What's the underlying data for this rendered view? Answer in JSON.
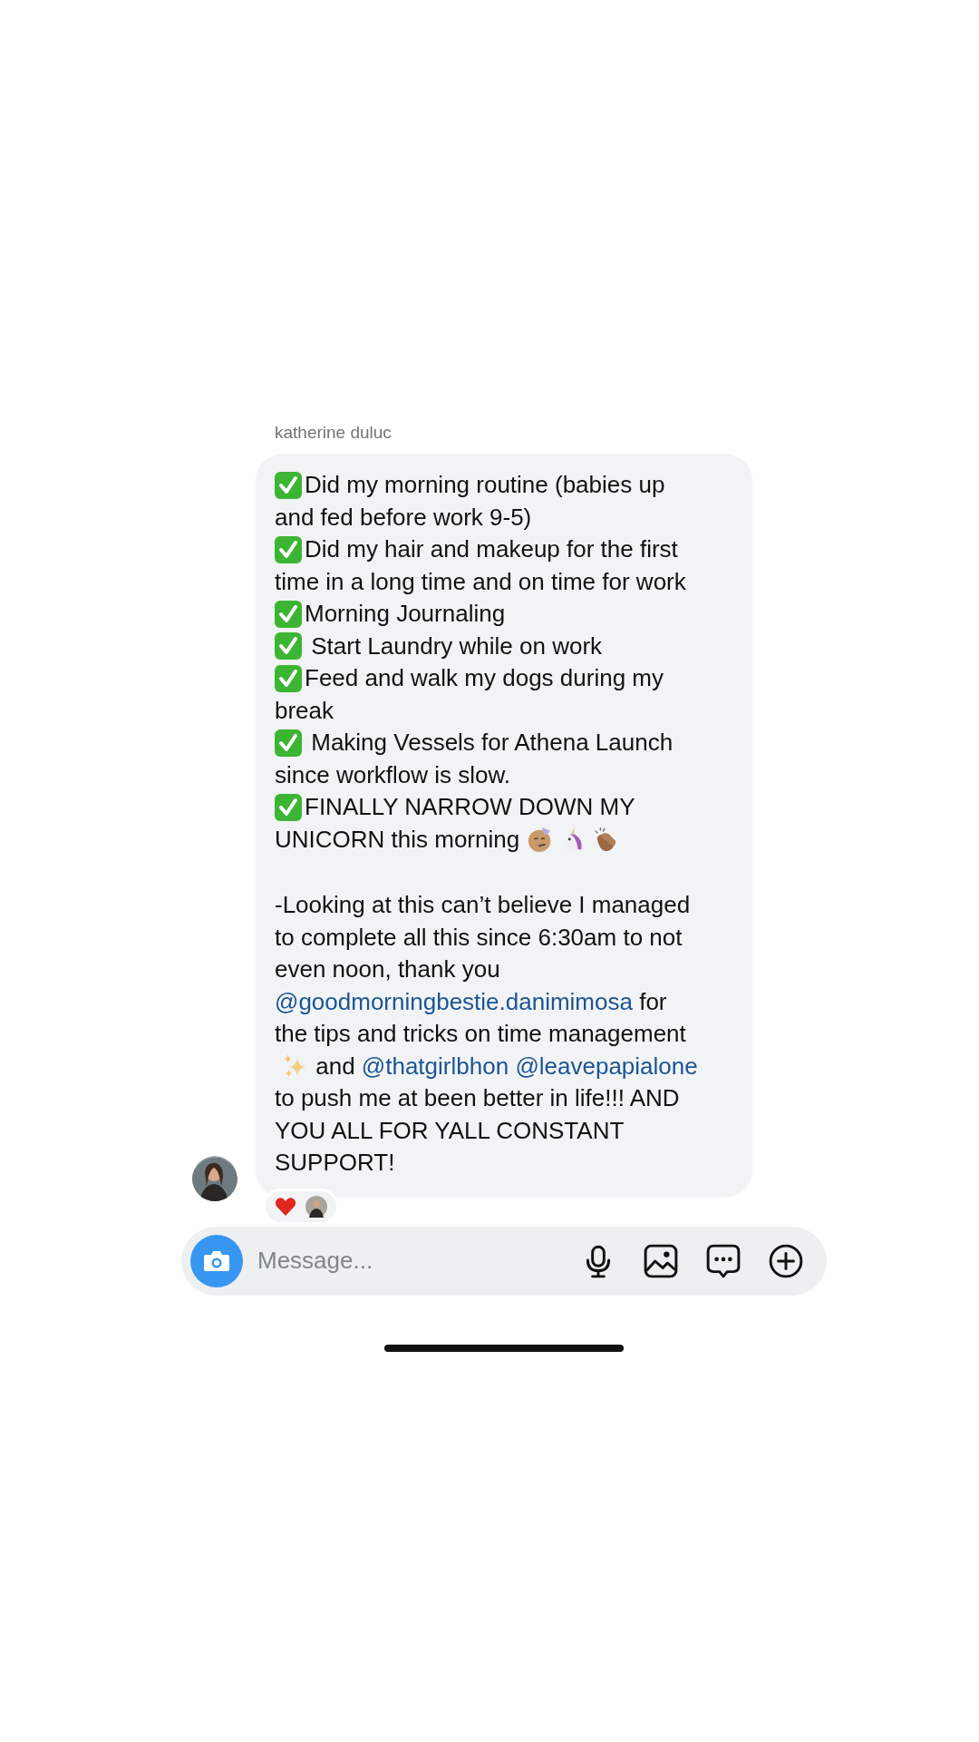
{
  "sender": {
    "name": "katherine duluc"
  },
  "message": {
    "paragraphs": [
      {
        "lines": [
          [
            {
              "kind": "check"
            },
            {
              "kind": "text",
              "text": "Did my morning routine (babies up"
            }
          ],
          [
            {
              "kind": "text",
              "text": "and fed before work 9-5)"
            }
          ],
          [
            {
              "kind": "check"
            },
            {
              "kind": "text",
              "text": "Did my hair and makeup for the first"
            }
          ],
          [
            {
              "kind": "text",
              "text": "time in a long time and on time for work"
            }
          ],
          [
            {
              "kind": "check"
            },
            {
              "kind": "text",
              "text": "Morning Journaling"
            }
          ],
          [
            {
              "kind": "check"
            },
            {
              "kind": "text",
              "text": " Start Laundry while on work"
            }
          ],
          [
            {
              "kind": "check"
            },
            {
              "kind": "text",
              "text": "Feed and walk my dogs during my"
            }
          ],
          [
            {
              "kind": "text",
              "text": "break"
            }
          ],
          [
            {
              "kind": "check"
            },
            {
              "kind": "text",
              "text": " Making Vessels for Athena Launch"
            }
          ],
          [
            {
              "kind": "text",
              "text": "since workflow is slow."
            }
          ],
          [
            {
              "kind": "check"
            },
            {
              "kind": "text",
              "text": "FINALLY NARROW DOWN MY"
            }
          ],
          [
            {
              "kind": "text",
              "text": "UNICORN this morning"
            },
            {
              "kind": "party"
            },
            {
              "kind": "unicorn"
            },
            {
              "kind": "clap"
            }
          ]
        ]
      },
      {
        "lines": [
          [
            {
              "kind": "text",
              "text": "-Looking at this can’t believe I managed"
            }
          ],
          [
            {
              "kind": "text",
              "text": "to complete all this since 6:30am to not"
            }
          ],
          [
            {
              "kind": "text",
              "text": "even noon, thank you"
            }
          ],
          [
            {
              "kind": "mention",
              "text": "@goodmorningbestie.danimimosa"
            },
            {
              "kind": "text",
              "text": " for"
            }
          ],
          [
            {
              "kind": "text",
              "text": "the tips and tricks on time management"
            }
          ],
          [
            {
              "kind": "sparkles"
            },
            {
              "kind": "text",
              "text": " and "
            },
            {
              "kind": "mention",
              "text": "@thatgirlbhon"
            },
            {
              "kind": "mention",
              "text": "@leavepapialone"
            }
          ],
          [
            {
              "kind": "text",
              "text": "to push me at been better in life!!! AND"
            }
          ],
          [
            {
              "kind": "text",
              "text": "YOU ALL FOR YALL CONSTANT"
            }
          ],
          [
            {
              "kind": "text",
              "text": "SUPPORT!"
            }
          ]
        ]
      }
    ]
  },
  "reaction": {
    "kind": "heart"
  },
  "composer": {
    "placeholder": "Message..."
  }
}
